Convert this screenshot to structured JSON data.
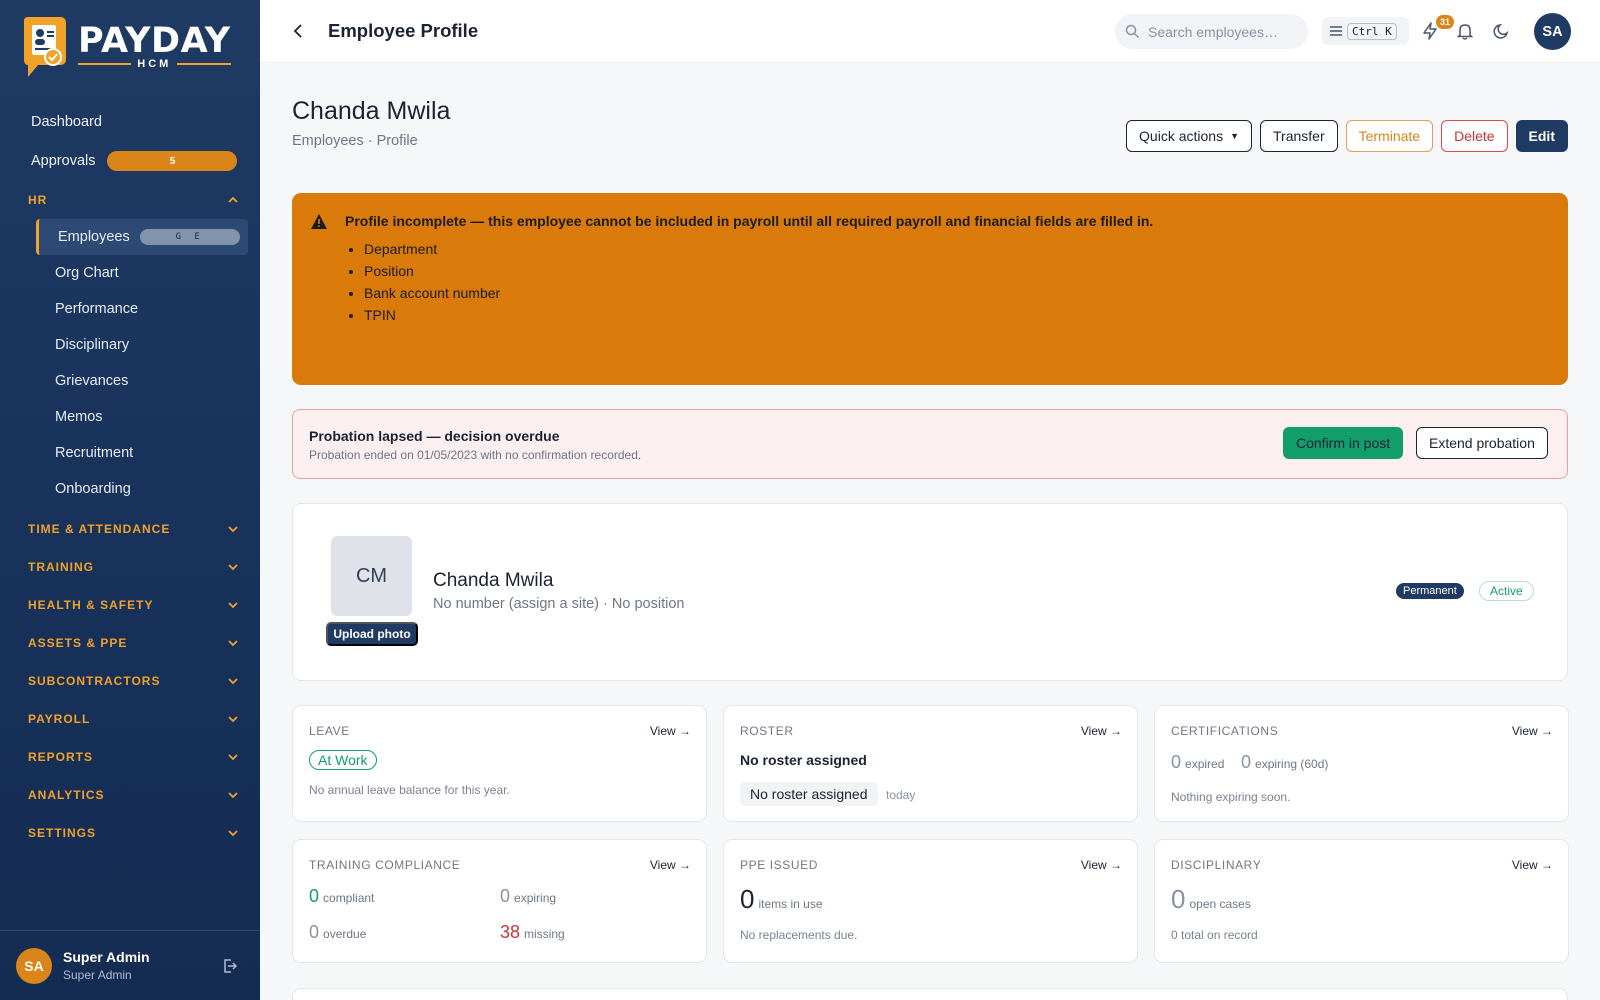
{
  "brand": {
    "name": "PAYDAY",
    "sub": "HCM"
  },
  "sidebar": {
    "dashboard": "Dashboard",
    "approvals": {
      "label": "Approvals",
      "count": "5"
    },
    "hr_section": "HR",
    "hr_items": [
      {
        "label": "Employees",
        "shortcut": "G E"
      },
      {
        "label": "Org Chart"
      },
      {
        "label": "Performance"
      },
      {
        "label": "Disciplinary"
      },
      {
        "label": "Grievances"
      },
      {
        "label": "Memos"
      },
      {
        "label": "Recruitment"
      },
      {
        "label": "Onboarding"
      }
    ],
    "sections": [
      "TIME & ATTENDANCE",
      "TRAINING",
      "HEALTH & SAFETY",
      "ASSETS & PPE",
      "SUBCONTRACTORS",
      "PAYROLL",
      "REPORTS",
      "ANALYTICS",
      "SETTINGS"
    ],
    "user": {
      "initials": "SA",
      "name": "Super Admin",
      "role": "Super Admin"
    }
  },
  "topbar": {
    "title": "Employee Profile",
    "search_placeholder": "Search employees…",
    "shortcut": "Ctrl K",
    "notifications_count": "31",
    "avatar": "SA"
  },
  "header": {
    "name": "Chanda Mwila",
    "breadcrumb": "Employees · Profile",
    "actions": {
      "quick": "Quick actions",
      "transfer": "Transfer",
      "terminate": "Terminate",
      "delete": "Delete",
      "edit": "Edit"
    }
  },
  "alert": {
    "title": "Profile incomplete — this employee cannot be included in payroll until all required payroll and financial fields are filled in.",
    "items": [
      "Department",
      "Position",
      "Bank account number",
      "TPIN"
    ]
  },
  "probation": {
    "title": "Probation lapsed — decision overdue",
    "subtitle": "Probation ended on 01/05/2023 with no confirmation recorded.",
    "confirm": "Confirm in post",
    "extend": "Extend probation"
  },
  "profile": {
    "initials": "CM",
    "upload": "Upload photo",
    "name": "Chanda Mwila",
    "subtitle": "No number (assign a site) · No position",
    "tag_type": "Permanent",
    "tag_status": "Active"
  },
  "cards": {
    "view": "View →",
    "leave": {
      "label": "LEAVE",
      "status": "At Work",
      "note": "No annual leave balance for this year."
    },
    "roster": {
      "label": "ROSTER",
      "title": "No roster assigned",
      "chip": "No roster assigned",
      "when": "today"
    },
    "certs": {
      "label": "CERTIFICATIONS",
      "expired_n": "0",
      "expired_l": "expired",
      "expiring_n": "0",
      "expiring_l": "expiring (60d)",
      "note": "Nothing expiring soon."
    },
    "training": {
      "label": "TRAINING COMPLIANCE",
      "compliant_n": "0",
      "compliant_l": "compliant",
      "expiring_n": "0",
      "expiring_l": "expiring",
      "overdue_n": "0",
      "overdue_l": "overdue",
      "missing_n": "38",
      "missing_l": "missing"
    },
    "ppe": {
      "label": "PPE ISSUED",
      "n": "0",
      "l": "items in use",
      "note": "No replacements due."
    },
    "disciplinary": {
      "label": "DISCIPLINARY",
      "n": "0",
      "l": "open cases",
      "note": "0 total on record"
    }
  },
  "colors": {
    "sidebar": "#1f3a63",
    "accent": "#d9851a",
    "success": "#119e6b",
    "danger": "#c93434"
  }
}
